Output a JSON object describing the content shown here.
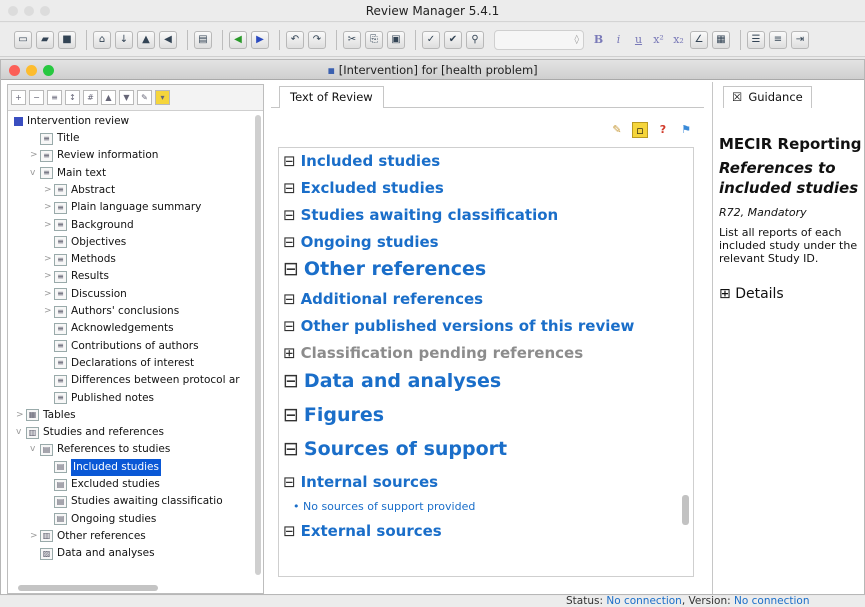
{
  "app_title": "Review Manager 5.4.1",
  "toolbar": {
    "format_buttons": [
      "B",
      "i",
      "u",
      "x²",
      "x₂"
    ]
  },
  "document": {
    "title": "[Intervention] for [health problem]"
  },
  "tree": {
    "root": "Intervention review",
    "items": [
      {
        "label": "Title",
        "level": 1,
        "expander": "",
        "icon": "doc-icon"
      },
      {
        "label": "Review information",
        "level": 1,
        "expander": ">",
        "icon": "doc-icon"
      },
      {
        "label": "Main text",
        "level": 1,
        "expander": "v",
        "icon": "doc-icon"
      },
      {
        "label": "Abstract",
        "level": 2,
        "expander": ">",
        "icon": "doc-icon"
      },
      {
        "label": "Plain language summary",
        "level": 2,
        "expander": ">",
        "icon": "doc-icon"
      },
      {
        "label": "Background",
        "level": 2,
        "expander": ">",
        "icon": "doc-icon"
      },
      {
        "label": "Objectives",
        "level": 2,
        "expander": "",
        "icon": "doc-icon"
      },
      {
        "label": "Methods",
        "level": 2,
        "expander": ">",
        "icon": "doc-icon"
      },
      {
        "label": "Results",
        "level": 2,
        "expander": ">",
        "icon": "doc-icon"
      },
      {
        "label": "Discussion",
        "level": 2,
        "expander": ">",
        "icon": "doc-icon"
      },
      {
        "label": "Authors' conclusions",
        "level": 2,
        "expander": ">",
        "icon": "doc-icon"
      },
      {
        "label": "Acknowledgements",
        "level": 2,
        "expander": "",
        "icon": "doc-icon"
      },
      {
        "label": "Contributions of authors",
        "level": 2,
        "expander": "",
        "icon": "doc-icon"
      },
      {
        "label": "Declarations of interest",
        "level": 2,
        "expander": "",
        "icon": "doc-icon"
      },
      {
        "label": "Differences between protocol ar",
        "level": 2,
        "expander": "",
        "icon": "doc-icon"
      },
      {
        "label": "Published notes",
        "level": 2,
        "expander": "",
        "icon": "doc-icon"
      },
      {
        "label": "Tables",
        "level": 0,
        "expander": ">",
        "icon": "table-icon"
      },
      {
        "label": "Studies and references",
        "level": 0,
        "expander": "v",
        "icon": "book-icon"
      },
      {
        "label": "References to studies",
        "level": 1,
        "expander": "v",
        "icon": "references-icon"
      },
      {
        "label": "Included studies",
        "level": 2,
        "expander": "",
        "icon": "studies-icon",
        "selected": true
      },
      {
        "label": "Excluded studies",
        "level": 2,
        "expander": "",
        "icon": "studies-icon"
      },
      {
        "label": "Studies awaiting classificatio",
        "level": 2,
        "expander": "",
        "icon": "studies-icon"
      },
      {
        "label": "Ongoing studies",
        "level": 2,
        "expander": "",
        "icon": "studies-icon"
      },
      {
        "label": "Other references",
        "level": 1,
        "expander": ">",
        "icon": "book-icon"
      },
      {
        "label": "Data and analyses",
        "level": 1,
        "expander": "",
        "icon": "data-icon"
      }
    ]
  },
  "editor": {
    "tab": "Text of Review",
    "sections": [
      {
        "label": "Included studies",
        "style": "s1",
        "box": "⊟"
      },
      {
        "label": "Excluded studies",
        "style": "s1",
        "box": "⊟"
      },
      {
        "label": "Studies awaiting classification",
        "style": "s1",
        "box": "⊟"
      },
      {
        "label": "Ongoing studies",
        "style": "s1",
        "box": "⊟"
      },
      {
        "label": "Other references",
        "style": "s2",
        "box": "⊟"
      },
      {
        "label": "Additional references",
        "style": "s1",
        "box": "⊟"
      },
      {
        "label": "Other published versions of this review",
        "style": "s1",
        "box": "⊟"
      },
      {
        "label": "Classification pending references",
        "style": "s1 gray",
        "box": "⊞"
      },
      {
        "label": "Data and analyses",
        "style": "s2",
        "box": "⊟"
      },
      {
        "label": "Figures",
        "style": "s2",
        "box": "⊟"
      },
      {
        "label": "Sources of support",
        "style": "s2",
        "box": "⊟"
      },
      {
        "label": "Internal sources",
        "style": "s1",
        "box": "⊟"
      },
      {
        "label": "External sources",
        "style": "s1",
        "box": "⊟"
      }
    ],
    "internal_bullet": "No sources of support provided"
  },
  "guidance": {
    "tab": "Guidance",
    "heading": "MECIR Reporting",
    "subheading": "References to included studies",
    "rule": "R72, Mandatory",
    "text": "List all reports of each included study under the relevant Study ID.",
    "details": "Details"
  },
  "status": {
    "label": "Status:",
    "status_value": "No connection",
    "version_label": "Version:",
    "version_value": "No connection"
  },
  "colors": {
    "link_blue": "#1a6ec9",
    "selection_blue": "#0a58d6"
  }
}
